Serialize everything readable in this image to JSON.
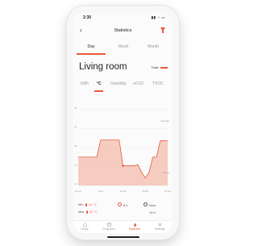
{
  "status": {
    "time": "2:30",
    "icons": "▮▮ ◔ ▭"
  },
  "header": {
    "title": "Statistics"
  },
  "periods": {
    "items": [
      "Day",
      "Week",
      "Month"
    ],
    "active": "Day"
  },
  "room": {
    "name": "Living room",
    "total_label": "Total:"
  },
  "units": {
    "items": [
      "kWh",
      "°C",
      "Humidity",
      "eCO2",
      "TVOC"
    ],
    "active": "°C"
  },
  "chart_data": {
    "type": "area",
    "y_ticks": [
      "30",
      "25",
      "20",
      "15",
      "10"
    ],
    "ylim": [
      10,
      30
    ],
    "x_ticks": [
      "15 jun",
      "6:00",
      "12:00",
      "18:00",
      "15 jun"
    ],
    "legend_high": "You high",
    "legend_low": "You low",
    "x": [
      0,
      1,
      2,
      3,
      4,
      5,
      6,
      7,
      8,
      9,
      10,
      11,
      12,
      13,
      14,
      15,
      16,
      17,
      18,
      19,
      20,
      21,
      22,
      23,
      24
    ],
    "values": [
      17.5,
      17.5,
      17.5,
      17.5,
      17.5,
      17.5,
      22,
      22,
      22,
      22,
      22,
      22,
      15.2,
      15.2,
      15.2,
      15.2,
      15.5,
      13.5,
      12,
      13.5,
      17.5,
      17.5,
      21.8,
      21.8,
      21.8
    ],
    "color": "#e85a3c"
  },
  "summary": {
    "min_label": "Min",
    "min_value": "12 °C",
    "max_label": "Max",
    "max_value": "22 °C",
    "sun_value": "8 h",
    "clock_label": "Now",
    "clock_value": "19 h"
  },
  "tabs": [
    {
      "label": "Home"
    },
    {
      "label": "Programs"
    },
    {
      "label": "Statistics"
    },
    {
      "label": "Settings"
    }
  ],
  "colors": {
    "accent": "#e85a3c"
  }
}
